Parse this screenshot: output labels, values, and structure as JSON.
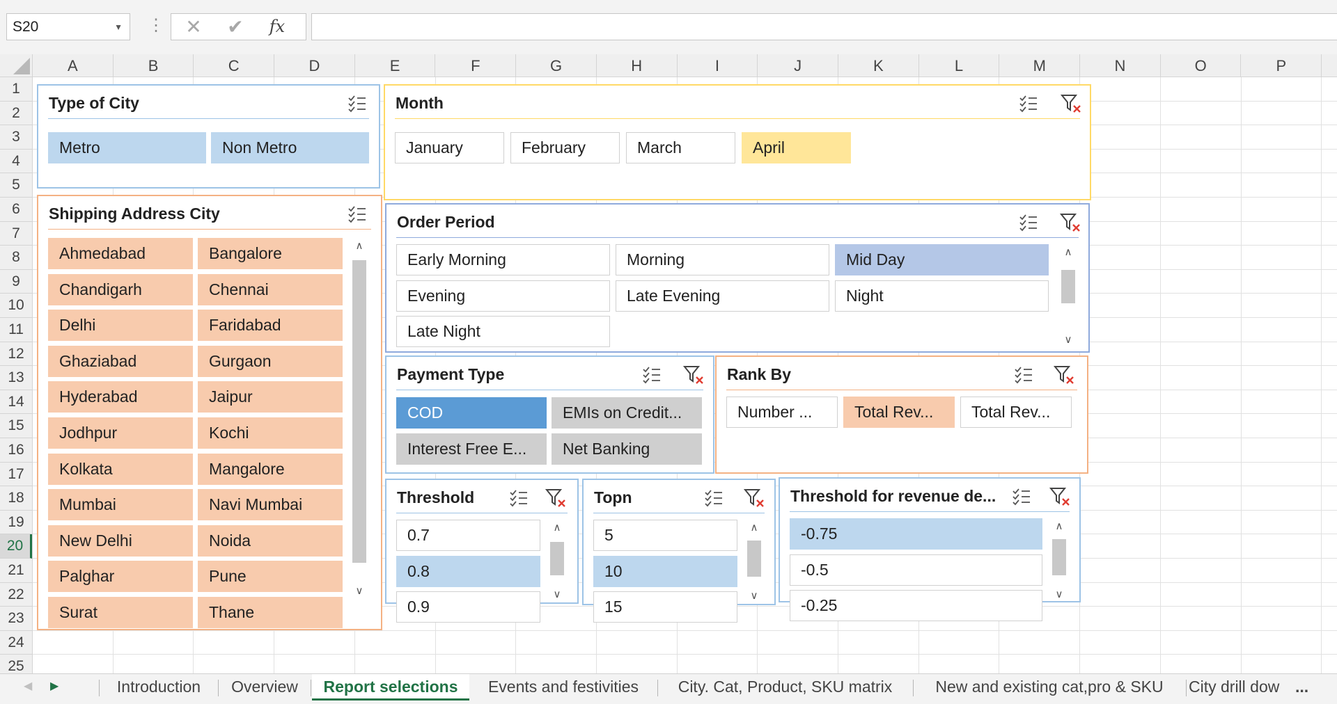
{
  "formula_bar": {
    "name_box": "S20",
    "fx_label": "fx",
    "cancel_glyph": "✕",
    "enter_glyph": "✔",
    "dots_glyph": "⋮",
    "formula": ""
  },
  "columns": [
    "A",
    "B",
    "C",
    "D",
    "E",
    "F",
    "G",
    "H",
    "I",
    "J",
    "K",
    "L",
    "M",
    "N",
    "O",
    "P"
  ],
  "rows": [
    "1",
    "2",
    "3",
    "4",
    "5",
    "6",
    "7",
    "8",
    "9",
    "10",
    "11",
    "12",
    "13",
    "14",
    "15",
    "16",
    "17",
    "18",
    "19",
    "20",
    "21",
    "22",
    "23",
    "24",
    "25"
  ],
  "active_row": "20",
  "slicers": {
    "type_of_city": {
      "title": "Type of City",
      "border_color": "#9dc3e6",
      "items": [
        "Metro",
        "Non Metro"
      ],
      "selected": [
        true,
        true
      ]
    },
    "month": {
      "title": "Month",
      "border_color": "#ffd966",
      "items": [
        "January",
        "February",
        "March",
        "April"
      ],
      "selected": [
        false,
        false,
        false,
        true
      ]
    },
    "shipping_city": {
      "title": "Shipping Address City",
      "border_color": "#f4b183",
      "items": [
        "Ahmedabad",
        "Bangalore",
        "Chandigarh",
        "Chennai",
        "Delhi",
        "Faridabad",
        "Ghaziabad",
        "Gurgaon",
        "Hyderabad",
        "Jaipur",
        "Jodhpur",
        "Kochi",
        "Kolkata",
        "Mangalore",
        "Mumbai",
        "Navi Mumbai",
        "New Delhi",
        "Noida",
        "Palghar",
        "Pune",
        "Surat",
        "Thane"
      ]
    },
    "order_period": {
      "title": "Order Period",
      "border_color": "#8faadc",
      "items": [
        "Early Morning",
        "Morning",
        "Mid Day",
        "Evening",
        "Late Evening",
        "Night",
        "Late Night"
      ],
      "selected": [
        false,
        false,
        true,
        false,
        false,
        false,
        false
      ]
    },
    "payment_type": {
      "title": "Payment Type",
      "border_color": "#9dc3e6",
      "items": [
        "COD",
        "EMIs on Credit...",
        "Interest Free E...",
        "Net Banking"
      ],
      "selected": [
        true,
        false,
        false,
        false
      ]
    },
    "rank_by": {
      "title": "Rank By",
      "border_color": "#f4b183",
      "items": [
        "Number ...",
        "Total Rev...",
        "Total Rev..."
      ],
      "selected": [
        false,
        true,
        false
      ]
    },
    "threshold": {
      "title": "Threshold",
      "border_color": "#9dc3e6",
      "items": [
        "0.7",
        "0.8",
        "0.9"
      ],
      "selected": [
        false,
        true,
        false
      ]
    },
    "topn": {
      "title": "Topn",
      "border_color": "#9dc3e6",
      "items": [
        "5",
        "10",
        "15"
      ],
      "selected": [
        false,
        true,
        false
      ]
    },
    "threshold_revenue": {
      "title": "Threshold for revenue de...",
      "border_color": "#9dc3e6",
      "items": [
        "-0.75",
        "-0.5",
        "-0.25"
      ],
      "selected": [
        true,
        false,
        false
      ]
    }
  },
  "sheet_tabs": {
    "tabs": [
      "Introduction",
      "Overview",
      "Report selections",
      "Events and festivities",
      "City. Cat, Product, SKU matrix",
      "New and existing cat,pro & SKU",
      "City drill dow"
    ],
    "active": "Report selections",
    "more": "..."
  },
  "icons": {
    "multi_select": "multi-select-icon",
    "clear_filter": "clear-filter-icon",
    "scroll_up": "chevron-up-icon",
    "scroll_down": "chevron-down-icon",
    "tab_prev": "triangle-left-icon",
    "tab_next": "triangle-right-icon"
  },
  "colors": {
    "accent_green": "#217346",
    "clear_filter_red": "#e03c31",
    "selected_blue_light": "#bdd7ee",
    "selected_blue_mid": "#b4c7e7",
    "selected_blue_strong": "#5b9bd5",
    "selected_yellow": "#ffe699",
    "selected_peach": "#f8cbad",
    "item_grey": "#cfcfcf"
  }
}
